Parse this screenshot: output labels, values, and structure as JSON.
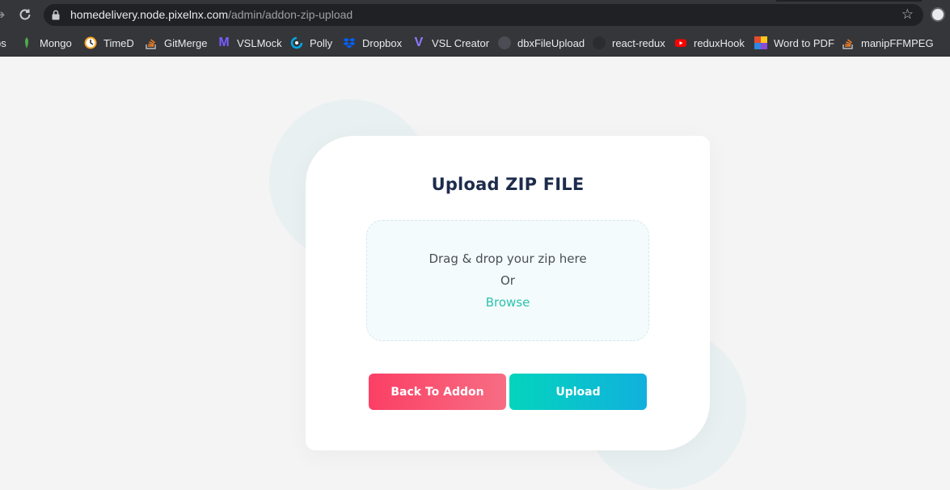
{
  "browser": {
    "url_host": "homedelivery.node.pixelnx.com",
    "url_path": "/admin/addon-zip-upload",
    "bookmarks": [
      {
        "label": "ps",
        "icon": "apps-icon"
      },
      {
        "label": "Mongo",
        "icon": "mongo-leaf-icon",
        "color": "#4fa94d"
      },
      {
        "label": "TimeD",
        "icon": "timer-icon",
        "color": "#f6a623"
      },
      {
        "label": "GitMerge",
        "icon": "stackoverflow-icon",
        "color": "#f48024"
      },
      {
        "label": "VSLMock",
        "icon": "vsl-m-icon",
        "color": "#7b5cff"
      },
      {
        "label": "Polly",
        "icon": "polly-icon",
        "color": "#00a8e8"
      },
      {
        "label": "Dropbox",
        "icon": "dropbox-icon",
        "color": "#0061ff"
      },
      {
        "label": "VSL Creator",
        "icon": "vsl-v-icon",
        "color": "#8c7bff"
      },
      {
        "label": "dbxFileUpload",
        "icon": "dbx-icon",
        "color": "#4a4d53"
      },
      {
        "label": "react-redux",
        "icon": "github-icon",
        "color": "#2b2c30"
      },
      {
        "label": "reduxHook",
        "icon": "youtube-icon",
        "color": "#ff0000"
      },
      {
        "label": "Word to PDF",
        "icon": "ilovepdf-icon",
        "color": "#e44c30"
      },
      {
        "label": "manipFFMPEG",
        "icon": "stackoverflow-icon",
        "color": "#f48024"
      }
    ]
  },
  "upload": {
    "title": "Upload ZIP FILE",
    "drop_text": "Drag & drop your zip here",
    "or_text": "Or",
    "browse_text": "Browse",
    "back_label": "Back To Addon",
    "upload_label": "Upload"
  },
  "colors": {
    "back_button": "#fb3f65",
    "upload_button": "#04d4bd",
    "browse_link": "#2cc2ad",
    "title": "#1d2c4c"
  }
}
